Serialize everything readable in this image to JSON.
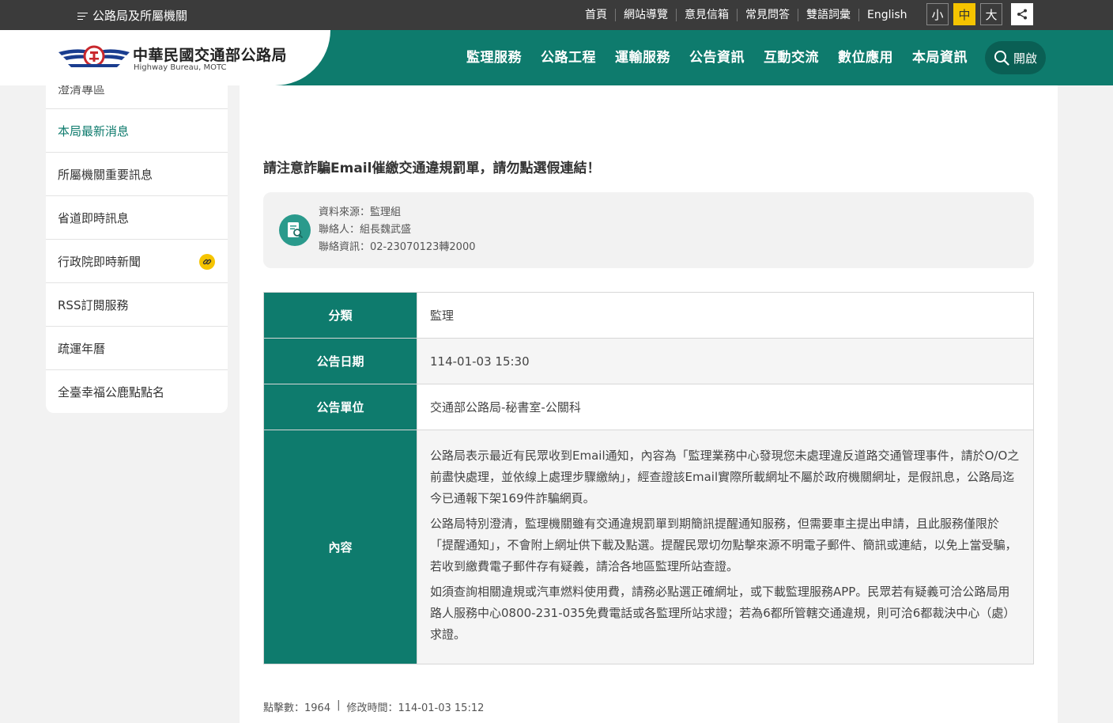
{
  "topbar": {
    "agency_menu": "公路局及所屬機關",
    "links": [
      "首頁",
      "網站導覽",
      "意見信箱",
      "常見問答",
      "雙語詞彙",
      "English"
    ],
    "font_sizes": [
      "小",
      "中",
      "大"
    ],
    "share_icon": "share-icon"
  },
  "header": {
    "logo_cn": "中華民國交通部公路局",
    "logo_en": "Highway Bureau, MOTC",
    "nav": [
      "監理服務",
      "公路工程",
      "運輸服務",
      "公告資訊",
      "互動交流",
      "數位應用",
      "本局資訊"
    ],
    "search_label": "開啟",
    "colors": {
      "brand": "#0e7b6d",
      "accent": "#f5c400",
      "topbar": "#3b3b3b"
    }
  },
  "sidebar": {
    "items": [
      {
        "label": "澄清專區"
      },
      {
        "label": "本局最新消息"
      },
      {
        "label": "所屬機關重要訊息"
      },
      {
        "label": "省道即時訊息"
      },
      {
        "label": "行政院即時新聞"
      },
      {
        "label": "RSS訂閱服務"
      },
      {
        "label": "疏運年曆"
      },
      {
        "label": "全臺幸福公鹿點點名"
      }
    ]
  },
  "article": {
    "title": "請注意詐騙Email催繳交通違規罰單，請勿點選假連結！",
    "source": "資料來源：監理組",
    "contact": "聯絡人：組長魏武盛",
    "contact_info": "聯絡資訊：02-23070123轉2000",
    "table": {
      "category_label": "分類",
      "category_value": "監理",
      "date_label": "公告日期",
      "date_value": "114-01-03 15:30",
      "unit_label": "公告單位",
      "unit_value": "交通部公路局-秘書室-公關科",
      "content_label": "內容",
      "paragraphs": [
        "公路局表示最近有民眾收到Email通知，內容為「監理業務中心發現您未處理違反道路交通管理事件，請於O/O之前盡快處理，並依線上處理步驟繳納」，經查證該Email實際所載網址不屬於政府機關網址，是假訊息，公路局迄今已通報下架169件詐騙網頁。",
        "公路局特別澄清，監理機關雖有交通違規罰單到期簡訊提醒通知服務，但需要車主提出申請，且此服務僅限於「提醒通知」，不會附上網址供下載及點選。提醒民眾切勿點擊來源不明電子郵件、簡訊或連結，以免上當受騙，若收到繳費電子郵件存有疑義，請洽各地區監理所站查證。",
        "如須查詢相關違規或汽車燃料使用費，請務必點選正確網址，或下載監理服務APP。民眾若有疑義可洽公路局用路人服務中心0800-231-035免費電話或各監理所站求證；若為6都所管轄交通違規，則可洽6都裁決中心（處）求證。"
      ]
    },
    "clicks": "點擊數：1964",
    "separator": "|",
    "modified": "修改時間：114-01-03 15:12"
  }
}
